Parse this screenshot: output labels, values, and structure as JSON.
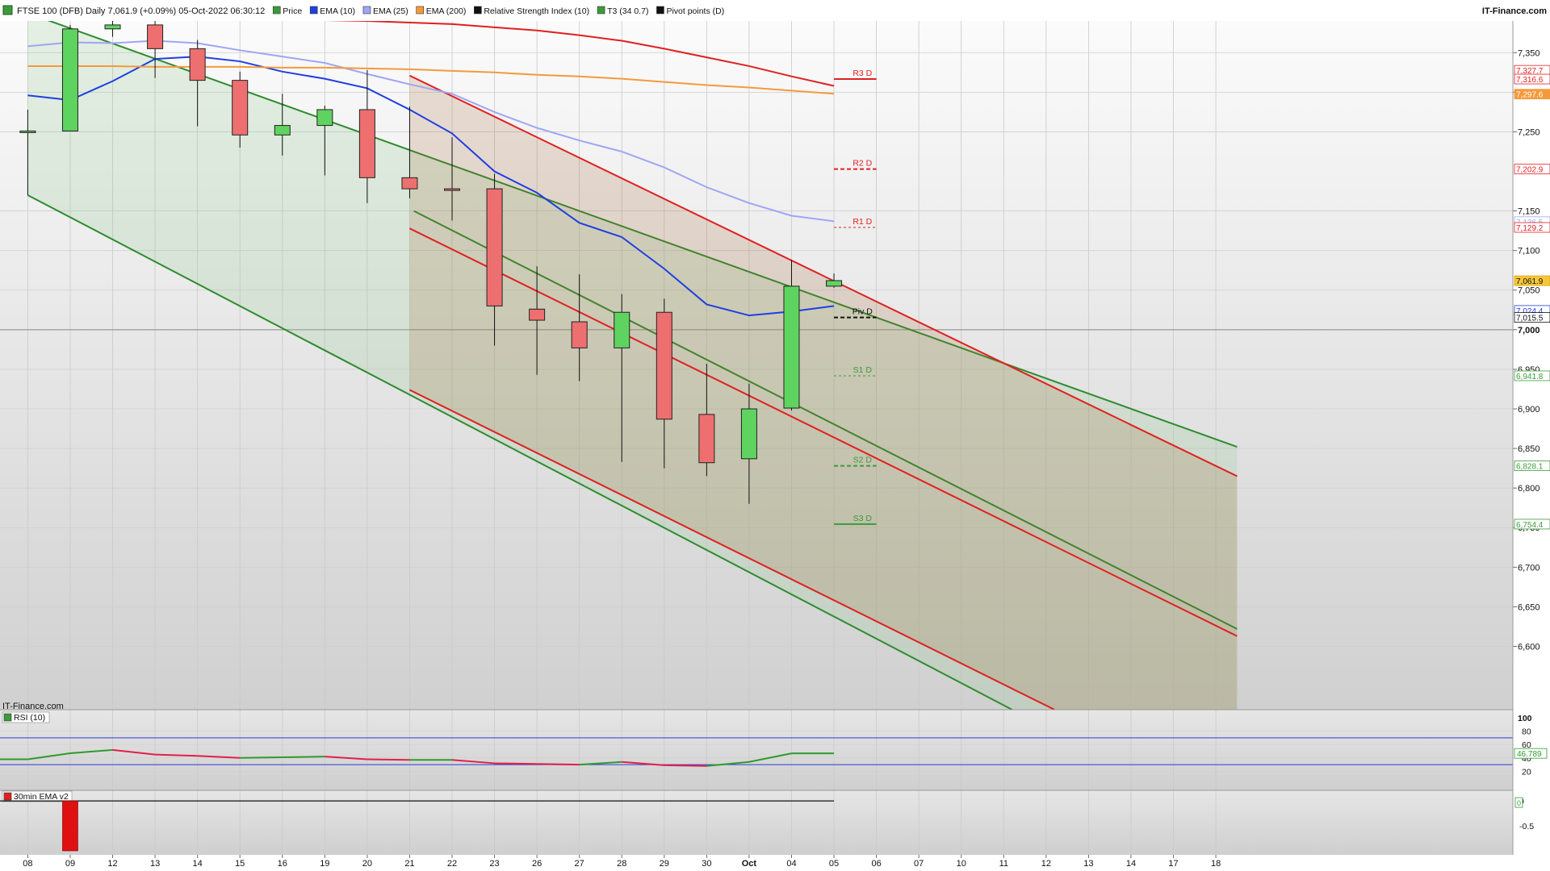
{
  "header": {
    "title": "FTSE 100 (DFB) Daily 7,061.9 (+0.09%) 05-Oct-2022 06:30:12",
    "brand": "IT-Finance.com"
  },
  "legend": [
    {
      "label": "Price",
      "color": "#3c9a3c"
    },
    {
      "label": "EMA (10)",
      "color": "#1f3fe0"
    },
    {
      "label": "EMA (25)",
      "color": "#9fa6f2"
    },
    {
      "label": "EMA (200)",
      "color": "#f59a3c"
    },
    {
      "label": "Relative Strength Index (10)",
      "color": "#111111"
    },
    {
      "label": "T3 (34 0.7)",
      "color": "#3c9a3c"
    },
    {
      "label": "Pivot points (D)",
      "color": "#111111"
    }
  ],
  "watermark": "IT-Finance.com",
  "chart_data": [
    {
      "type": "candlestick",
      "title": "FTSE 100 (DFB) Daily",
      "x_labels": [
        "08",
        "09",
        "12",
        "13",
        "14",
        "15",
        "16",
        "19",
        "20",
        "21",
        "22",
        "23",
        "26",
        "27",
        "28",
        "29",
        "30",
        "Oct",
        "04",
        "05",
        "06",
        "07",
        "10",
        "11",
        "12",
        "13",
        "14",
        "17",
        "18"
      ],
      "ylim": [
        6520,
        7390
      ],
      "y_ticks": [
        6600,
        6650,
        6700,
        6750,
        6800,
        6850,
        6900,
        6950,
        7000,
        7050,
        7100,
        7150,
        7250,
        7300,
        7350
      ],
      "y_tick_labels": [
        "6,600",
        "6,650",
        "6,700",
        "6,750",
        "6,800",
        "6,850",
        "6,900",
        "6,950",
        "7,000",
        "7,050",
        "7,100",
        "7,150",
        "7,250",
        "7,300",
        "7,350"
      ],
      "candles": [
        {
          "x": "08",
          "open": 7250,
          "high": 7278,
          "low": 7170,
          "close": 7251
        },
        {
          "x": "09",
          "open": 7251,
          "high": 7385,
          "low": 7251,
          "close": 7380
        },
        {
          "x": "12",
          "open": 7380,
          "high": 7395,
          "low": 7370,
          "close": 7385
        },
        {
          "x": "13",
          "open": 7385,
          "high": 7395,
          "low": 7318,
          "close": 7355
        },
        {
          "x": "14",
          "open": 7355,
          "high": 7366,
          "low": 7257,
          "close": 7315
        },
        {
          "x": "15",
          "open": 7315,
          "high": 7326,
          "low": 7230,
          "close": 7246
        },
        {
          "x": "16",
          "open": 7246,
          "high": 7298,
          "low": 7220,
          "close": 7258
        },
        {
          "x": "19",
          "open": 7258,
          "high": 7283,
          "low": 7195,
          "close": 7278
        },
        {
          "x": "20",
          "open": 7278,
          "high": 7328,
          "low": 7160,
          "close": 7192
        },
        {
          "x": "21",
          "open": 7192,
          "high": 7282,
          "low": 7166,
          "close": 7178
        },
        {
          "x": "22",
          "open": 7178,
          "high": 7243,
          "low": 7138,
          "close": 7177
        },
        {
          "x": "23",
          "open": 7178,
          "high": 7197,
          "low": 6980,
          "close": 7030
        },
        {
          "x": "26",
          "open": 7026,
          "high": 7080,
          "low": 6943,
          "close": 7012
        },
        {
          "x": "27",
          "open": 7010,
          "high": 7070,
          "low": 6935,
          "close": 6977
        },
        {
          "x": "28",
          "open": 6977,
          "high": 7045,
          "low": 6833,
          "close": 7022
        },
        {
          "x": "29",
          "open": 7022,
          "high": 7039,
          "low": 6825,
          "close": 6887
        },
        {
          "x": "30",
          "open": 6893,
          "high": 6957,
          "low": 6815,
          "close": 6832
        },
        {
          "x": "Oct",
          "open": 6837,
          "high": 6932,
          "low": 6780,
          "close": 6900
        },
        {
          "x": "04",
          "open": 6901,
          "high": 7088,
          "low": 6898,
          "close": 7055
        },
        {
          "x": "05",
          "open": 7055,
          "high": 7071,
          "low": 7053,
          "close": 7062
        }
      ],
      "series": [
        {
          "name": "EMA (10)",
          "color": "#1f3fe0",
          "values": [
            7296,
            7290,
            7314,
            7342,
            7345,
            7339,
            7326,
            7317,
            7305,
            7278,
            7248,
            7200,
            7173,
            7135,
            7117,
            7077,
            7032,
            7018,
            7023,
            7030
          ]
        },
        {
          "name": "EMA (25)",
          "color": "#9fa6f2",
          "values": [
            7358,
            7363,
            7362,
            7365,
            7362,
            7353,
            7345,
            7337,
            7323,
            7310,
            7298,
            7275,
            7255,
            7239,
            7225,
            7205,
            7180,
            7160,
            7144,
            7137
          ]
        },
        {
          "name": "EMA (200)",
          "color": "#f59a3c",
          "values": [
            7333,
            7333,
            7333,
            7332,
            7332,
            7332,
            7331,
            7331,
            7330,
            7329,
            7327,
            7325,
            7322,
            7320,
            7317,
            7313,
            7309,
            7306,
            7302,
            7298
          ]
        },
        {
          "name": "T3 (34 0.7)",
          "color": "#e02020",
          "values": [
            7398,
            7398,
            7396,
            7395,
            7394,
            7393,
            7392,
            7391,
            7390,
            7388,
            7386,
            7382,
            7378,
            7372,
            7365,
            7355,
            7344,
            7333,
            7320,
            7308
          ]
        }
      ],
      "pivots": [
        {
          "label": "R3 D",
          "value": 7316.6,
          "color": "#e02020",
          "style": "solid"
        },
        {
          "label": "R2 D",
          "value": 7202.9,
          "color": "#e02020",
          "style": "dashed"
        },
        {
          "label": "R1 D",
          "value": 7129.2,
          "color": "#e02020",
          "style": "dotted"
        },
        {
          "label": "Piv D",
          "value": 7015.5,
          "color": "#111111",
          "style": "dashed"
        },
        {
          "label": "S1 D",
          "value": 6941.8,
          "color": "#3c9a3c",
          "style": "dotted"
        },
        {
          "label": "S2 D",
          "value": 6828.1,
          "color": "#3c9a3c",
          "style": "dashed"
        },
        {
          "label": "S3 D",
          "value": 6754.4,
          "color": "#3c9a3c",
          "style": "solid"
        }
      ],
      "channels": [
        {
          "name": "green-channel",
          "color": "#2e8b2e",
          "fill": "rgba(140,200,140,0.22)",
          "upper": [
            [
              0,
              7400
            ],
            [
              28.5,
              6852
            ]
          ],
          "middle": [
            [
              9.1,
              7150
            ],
            [
              28.5,
              6622
            ]
          ],
          "lower": [
            [
              0,
              7170
            ],
            [
              23.2,
              6520
            ]
          ]
        },
        {
          "name": "red-channel",
          "color": "#e02020",
          "fill": "rgba(160,95,40,0.18)",
          "upper": [
            [
              9.0,
              7321
            ],
            [
              28.5,
              6815
            ]
          ],
          "middle": [
            [
              9.0,
              7128
            ],
            [
              28.5,
              6613
            ]
          ],
          "lower": [
            [
              9.0,
              6924
            ],
            [
              24.2,
              6520
            ]
          ]
        }
      ],
      "price_labels": [
        {
          "text": "7,327.7",
          "value": 7327.7,
          "bg": "#ffffff",
          "fg": "#e02020",
          "border": "#e02020"
        },
        {
          "text": "7,316.6",
          "value": 7316.6,
          "bg": "#ffffff",
          "fg": "#e02020",
          "border": "#e02020"
        },
        {
          "text": "7,297.6",
          "value": 7297.6,
          "bg": "#f59a3c",
          "fg": "#ffffff",
          "border": "#f59a3c"
        },
        {
          "text": "7,202.9",
          "value": 7202.9,
          "bg": "#ffffff",
          "fg": "#e02020",
          "border": "#e02020"
        },
        {
          "text": "7,136.5",
          "value": 7136.5,
          "bg": "#ffffff",
          "fg": "#9fa6f2",
          "border": "#9fa6f2"
        },
        {
          "text": "7,129.2",
          "value": 7129.2,
          "bg": "#ffffff",
          "fg": "#e02020",
          "border": "#e02020"
        },
        {
          "text": "7,061.9",
          "value": 7061.9,
          "bg": "#f6c73a",
          "fg": "#111111",
          "border": "#d9a400"
        },
        {
          "text": "7,024.4",
          "value": 7024.4,
          "bg": "#ffffff",
          "fg": "#1f3fe0",
          "border": "#1f3fe0"
        },
        {
          "text": "7,015.5",
          "value": 7015.5,
          "bg": "#ffffff",
          "fg": "#111111",
          "border": "#111111"
        },
        {
          "text": "6,941.8",
          "value": 6941.8,
          "bg": "#ffffff",
          "fg": "#3c9a3c",
          "border": "#3c9a3c"
        },
        {
          "text": "6,828.1",
          "value": 6828.1,
          "bg": "#ffffff",
          "fg": "#3c9a3c",
          "border": "#3c9a3c"
        },
        {
          "text": "6,754.4",
          "value": 6754.4,
          "bg": "#ffffff",
          "fg": "#3c9a3c",
          "border": "#3c9a3c"
        }
      ]
    },
    {
      "type": "line",
      "title": "RSI (10)",
      "ylim": [
        0,
        100
      ],
      "y_ticks": [
        20,
        40,
        60,
        80,
        100
      ],
      "y_tick_labels": [
        "20",
        "40",
        "60",
        "80",
        "100"
      ],
      "levels": [
        70,
        30
      ],
      "series": [
        {
          "name": "RSI (10)",
          "values": [
            38,
            47,
            52,
            45,
            43,
            40,
            41,
            42,
            38,
            37,
            37,
            32,
            31,
            30,
            34,
            29,
            28,
            34,
            46.8,
            46.8
          ]
        }
      ],
      "value_label": "46.789"
    },
    {
      "type": "bar",
      "title": "30min EMA v2",
      "ylim": [
        -1,
        0.05
      ],
      "y_ticks": [
        0,
        -0.5
      ],
      "y_tick_labels": [
        "0",
        "-0.5"
      ],
      "values": [
        {
          "x": "09",
          "value": -1
        }
      ],
      "value_label": "0"
    }
  ]
}
